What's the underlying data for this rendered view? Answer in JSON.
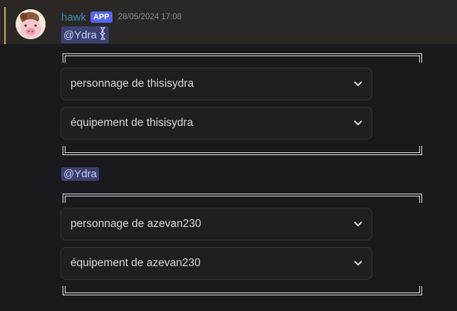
{
  "message": {
    "author": "hawk",
    "badge": "APP",
    "timestamp": "28/05/2024 17:08",
    "avatar_icon": "pig-avatar-icon"
  },
  "groups": [
    {
      "mention": "@Ydra",
      "selects": [
        {
          "label": "personnage de thisisydra"
        },
        {
          "label": "équipement de thisisydra"
        }
      ]
    },
    {
      "mention": "@Ydra",
      "selects": [
        {
          "label": "personnage de azevan230"
        },
        {
          "label": "équipement de azevan230"
        }
      ]
    }
  ],
  "colors": {
    "background": "#1a1a1e",
    "highlight": "#2a2724",
    "username": "#3e8fbf",
    "badge": "#5865f2",
    "mention_bg": "#3c4270"
  }
}
